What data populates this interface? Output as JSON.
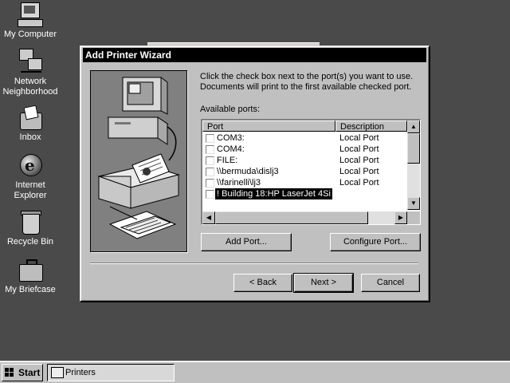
{
  "desktop": {
    "icons": [
      {
        "label": "My Computer",
        "icon": "computer-icon"
      },
      {
        "label": "Network Neighborhood",
        "icon": "network-icon"
      },
      {
        "label": "Inbox",
        "icon": "inbox-icon"
      },
      {
        "label": "Internet Explorer",
        "icon": "internet-explorer-icon"
      },
      {
        "label": "Recycle Bin",
        "icon": "recycle-bin-icon"
      },
      {
        "label": "My Briefcase",
        "icon": "briefcase-icon"
      }
    ]
  },
  "dialog": {
    "title": "Add Printer Wizard",
    "instruction_line1": "Click the check box next to the port(s) you want to use.",
    "instruction_line2": "Documents will print to the first available checked port.",
    "available_ports_label": "Available ports:",
    "columns": {
      "port": "Port",
      "description": "Description"
    },
    "ports": [
      {
        "name": "COM3:",
        "description": "Local Port",
        "checked": false,
        "selected": false
      },
      {
        "name": "COM4:",
        "description": "Local Port",
        "checked": false,
        "selected": false
      },
      {
        "name": "FILE:",
        "description": "Local Port",
        "checked": false,
        "selected": false
      },
      {
        "name": "\\\\bermuda\\dislj3",
        "description": "Local Port",
        "checked": false,
        "selected": false
      },
      {
        "name": "\\\\farinelli\\lj3",
        "description": "Local Port",
        "checked": false,
        "selected": false
      },
      {
        "name": "! Building 18:HP LaserJet 4Si",
        "description": "",
        "checked": false,
        "selected": true
      }
    ],
    "buttons": {
      "add_port": "Add Port...",
      "configure_port": "Configure Port...",
      "back": "< Back",
      "next": "Next >",
      "cancel": "Cancel"
    }
  },
  "taskbar": {
    "start_label": "Start",
    "tasks": [
      {
        "label": "Printers",
        "icon": "printers-folder-icon"
      }
    ]
  },
  "colors": {
    "desktop": "#4a4a4a",
    "window_face": "#c0c0c0",
    "title_bar": "#000000",
    "selection": "#000000"
  }
}
